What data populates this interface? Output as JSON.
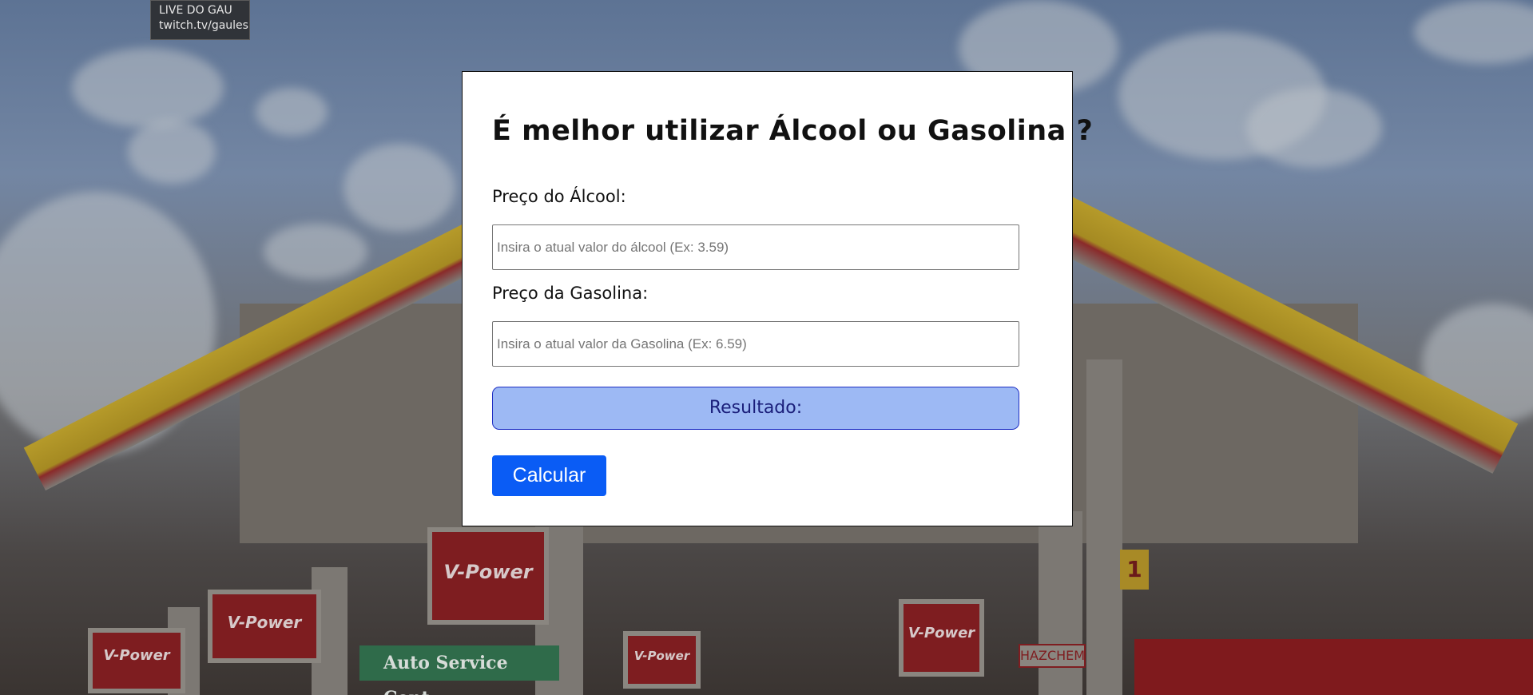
{
  "overlay": {
    "line1": "LIVE DO GAU",
    "line2": "twitch.tv/gaules"
  },
  "form": {
    "title": "É melhor utilizar Álcool ou Gasolina ?",
    "alcool_label": "Preço do Álcool:",
    "alcool_placeholder": "Insira o atual valor do álcool (Ex: 3.59)",
    "alcool_value": "",
    "gasolina_label": "Preço da Gasolina:",
    "gasolina_placeholder": "Insira o atual valor da Gasolina (Ex: 6.59)",
    "gasolina_value": "",
    "result_label": "Resultado:",
    "calc_button": "Calcular"
  },
  "background": {
    "signs": [
      "V-Power",
      "V-Power",
      "V-Power",
      "V-Power",
      "V-Power"
    ],
    "banner": "Auto Service Cent",
    "hazchem": "HAZCHEM",
    "pump_number": "1",
    "colors": {
      "shell_yellow": "#b59a2a",
      "shell_red": "#7e1d20",
      "sky": "#6b7f9c"
    }
  },
  "colors": {
    "result_bg": "#9db9f4",
    "result_border": "#1f2fc4",
    "button_bg": "#0a5cf5"
  }
}
